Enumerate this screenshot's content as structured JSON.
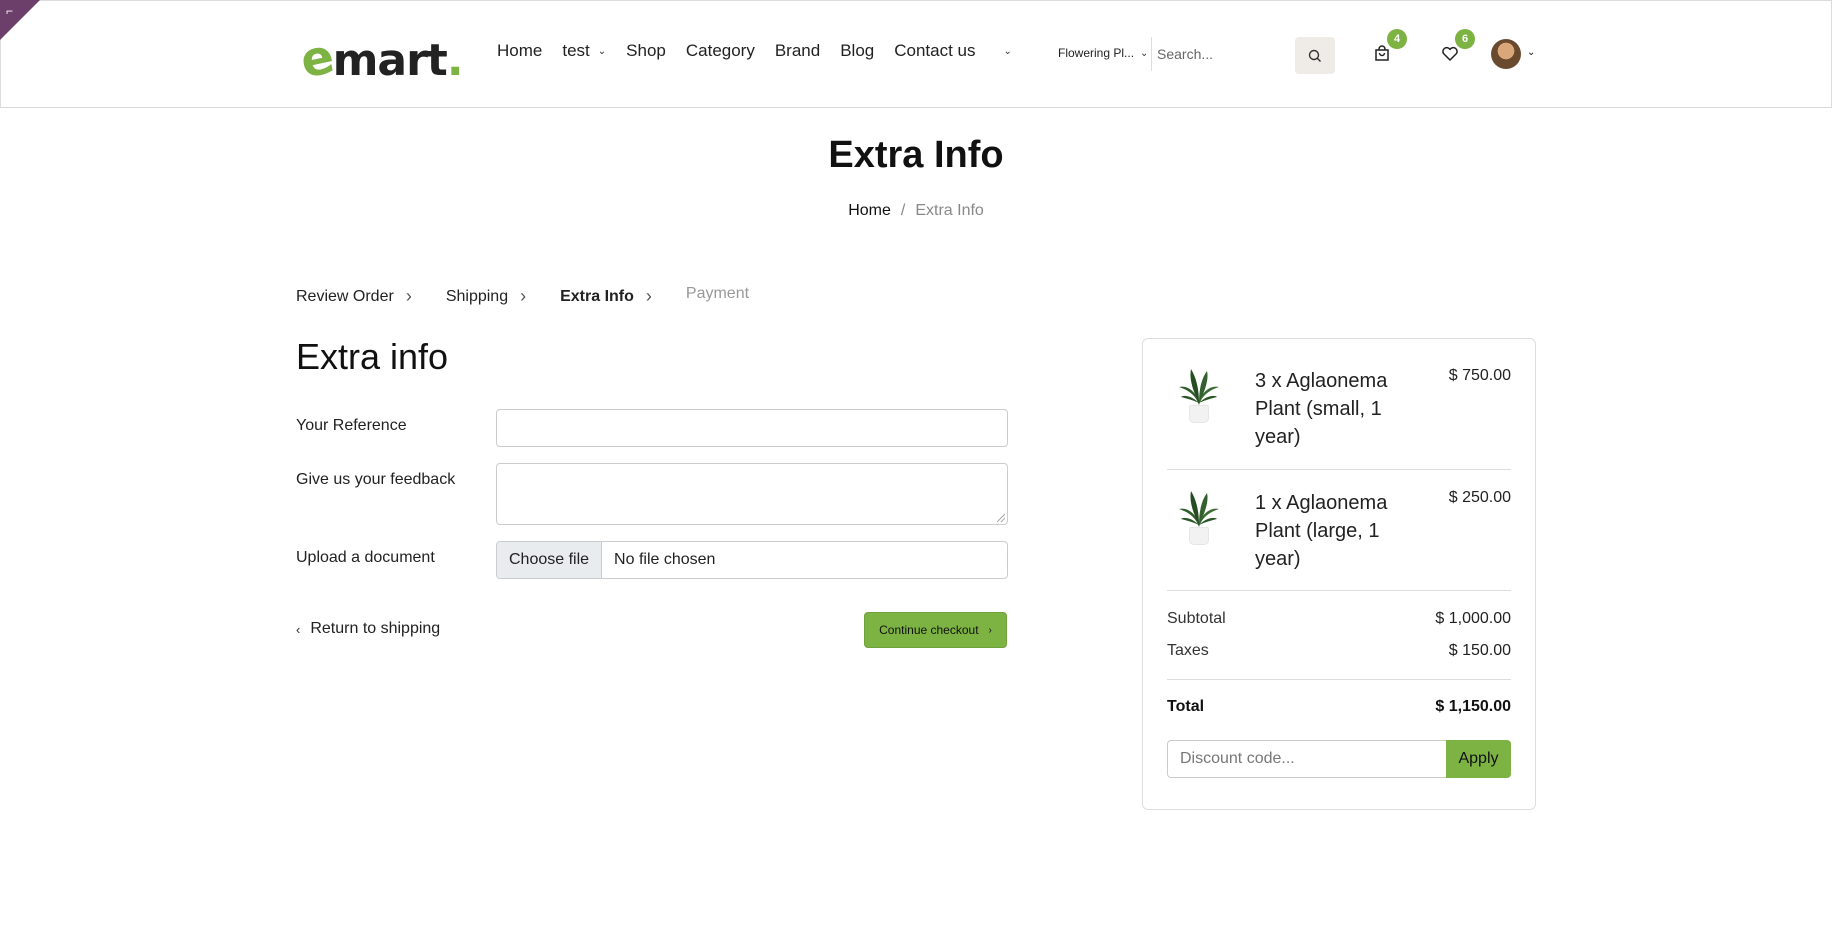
{
  "header": {
    "logo_main": "mart",
    "logo_e": "e",
    "logo_dot": ".",
    "nav": [
      {
        "label": "Home",
        "has_dropdown": false
      },
      {
        "label": "test",
        "has_dropdown": true
      },
      {
        "label": "Shop",
        "has_dropdown": false
      },
      {
        "label": "Category",
        "has_dropdown": false
      },
      {
        "label": "Brand",
        "has_dropdown": false
      },
      {
        "label": "Blog",
        "has_dropdown": false
      },
      {
        "label": "Contact us",
        "has_dropdown": false
      }
    ],
    "category_select": "Flowering Pl...",
    "search_placeholder": "Search...",
    "cart_count": "4",
    "wishlist_count": "6",
    "accent_color": "#7cb342"
  },
  "page": {
    "title": "Extra Info",
    "breadcrumb": {
      "home": "Home",
      "separator": "/",
      "current": "Extra Info"
    }
  },
  "steps": [
    {
      "label": "Review Order",
      "state": "done"
    },
    {
      "label": "Shipping",
      "state": "done"
    },
    {
      "label": "Extra Info",
      "state": "active"
    },
    {
      "label": "Payment",
      "state": "disabled"
    }
  ],
  "form": {
    "title": "Extra info",
    "reference_label": "Your Reference",
    "feedback_label": "Give us your feedback",
    "upload_label": "Upload a document",
    "choose_file_label": "Choose file",
    "file_status": "No file chosen",
    "return_label": "Return to shipping",
    "continue_label": "Continue checkout"
  },
  "summary": {
    "lines": [
      {
        "name": "3 x Aglaonema Plant (small, 1 year)",
        "price": "$ 750.00"
      },
      {
        "name": "1 x Aglaonema Plant (large, 1 year)",
        "price": "$ 250.00"
      }
    ],
    "subtotal_label": "Subtotal",
    "subtotal": "$ 1,000.00",
    "taxes_label": "Taxes",
    "taxes": "$ 150.00",
    "total_label": "Total",
    "total": "$ 1,150.00",
    "discount_placeholder": "Discount code...",
    "apply_label": "Apply"
  }
}
